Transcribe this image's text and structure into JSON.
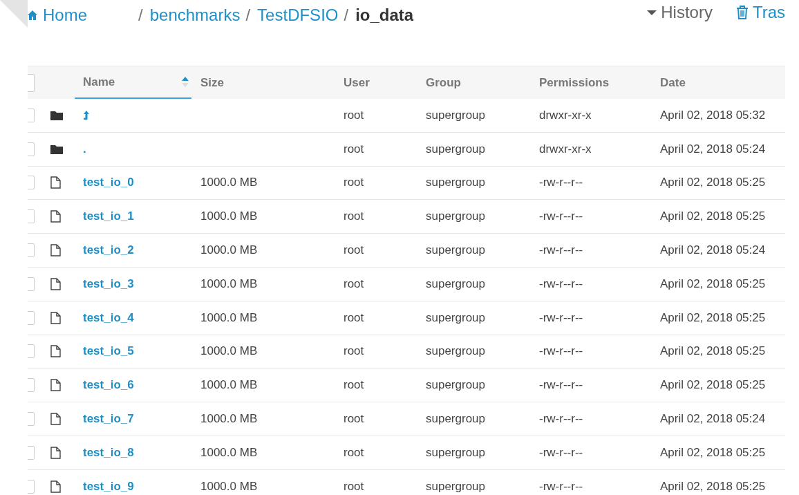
{
  "breadcrumb": [
    {
      "kind": "home",
      "label": "Home"
    },
    {
      "kind": "separator",
      "label": "/"
    },
    {
      "kind": "link",
      "label": "benchmarks"
    },
    {
      "kind": "separator",
      "label": "/"
    },
    {
      "kind": "link",
      "label": "TestDFSIO"
    },
    {
      "kind": "separator",
      "label": "/"
    },
    {
      "kind": "current",
      "label": "io_data"
    }
  ],
  "actions": [
    {
      "kind": "history",
      "label": "History"
    },
    {
      "kind": "trash",
      "label": "Tras"
    }
  ],
  "table": {
    "all_checked": false,
    "columns": [
      {
        "label": "Name",
        "sorted": true
      },
      {
        "label": "Size",
        "sorted": false
      },
      {
        "label": "User",
        "sorted": false
      },
      {
        "label": "Group",
        "sorted": false
      },
      {
        "label": "Permissions",
        "sorted": false
      },
      {
        "label": "Date",
        "sorted": false
      }
    ],
    "rows": [
      {
        "kind": "parent",
        "checked": false,
        "name": "",
        "size": "",
        "user": "root",
        "group": "supergroup",
        "permissions": "drwxr-xr-x",
        "date": "April 02, 2018 05:32"
      },
      {
        "kind": "folder",
        "checked": false,
        "name": ".",
        "size": "",
        "user": "root",
        "group": "supergroup",
        "permissions": "drwxr-xr-x",
        "date": "April 02, 2018 05:24"
      },
      {
        "kind": "file",
        "checked": false,
        "name": "test_io_0",
        "size": "1000.0 MB",
        "user": "root",
        "group": "supergroup",
        "permissions": "-rw-r--r--",
        "date": "April 02, 2018 05:25"
      },
      {
        "kind": "file",
        "checked": false,
        "name": "test_io_1",
        "size": "1000.0 MB",
        "user": "root",
        "group": "supergroup",
        "permissions": "-rw-r--r--",
        "date": "April 02, 2018 05:25"
      },
      {
        "kind": "file",
        "checked": false,
        "name": "test_io_2",
        "size": "1000.0 MB",
        "user": "root",
        "group": "supergroup",
        "permissions": "-rw-r--r--",
        "date": "April 02, 2018 05:24"
      },
      {
        "kind": "file",
        "checked": false,
        "name": "test_io_3",
        "size": "1000.0 MB",
        "user": "root",
        "group": "supergroup",
        "permissions": "-rw-r--r--",
        "date": "April 02, 2018 05:25"
      },
      {
        "kind": "file",
        "checked": false,
        "name": "test_io_4",
        "size": "1000.0 MB",
        "user": "root",
        "group": "supergroup",
        "permissions": "-rw-r--r--",
        "date": "April 02, 2018 05:25"
      },
      {
        "kind": "file",
        "checked": false,
        "name": "test_io_5",
        "size": "1000.0 MB",
        "user": "root",
        "group": "supergroup",
        "permissions": "-rw-r--r--",
        "date": "April 02, 2018 05:25"
      },
      {
        "kind": "file",
        "checked": false,
        "name": "test_io_6",
        "size": "1000.0 MB",
        "user": "root",
        "group": "supergroup",
        "permissions": "-rw-r--r--",
        "date": "April 02, 2018 05:25"
      },
      {
        "kind": "file",
        "checked": false,
        "name": "test_io_7",
        "size": "1000.0 MB",
        "user": "root",
        "group": "supergroup",
        "permissions": "-rw-r--r--",
        "date": "April 02, 2018 05:24"
      },
      {
        "kind": "file",
        "checked": false,
        "name": "test_io_8",
        "size": "1000.0 MB",
        "user": "root",
        "group": "supergroup",
        "permissions": "-rw-r--r--",
        "date": "April 02, 2018 05:25"
      },
      {
        "kind": "file",
        "checked": false,
        "name": "test_io_9",
        "size": "1000.0 MB",
        "user": "root",
        "group": "supergroup",
        "permissions": "-rw-r--r--",
        "date": "April 02, 2018 05:25"
      }
    ]
  }
}
